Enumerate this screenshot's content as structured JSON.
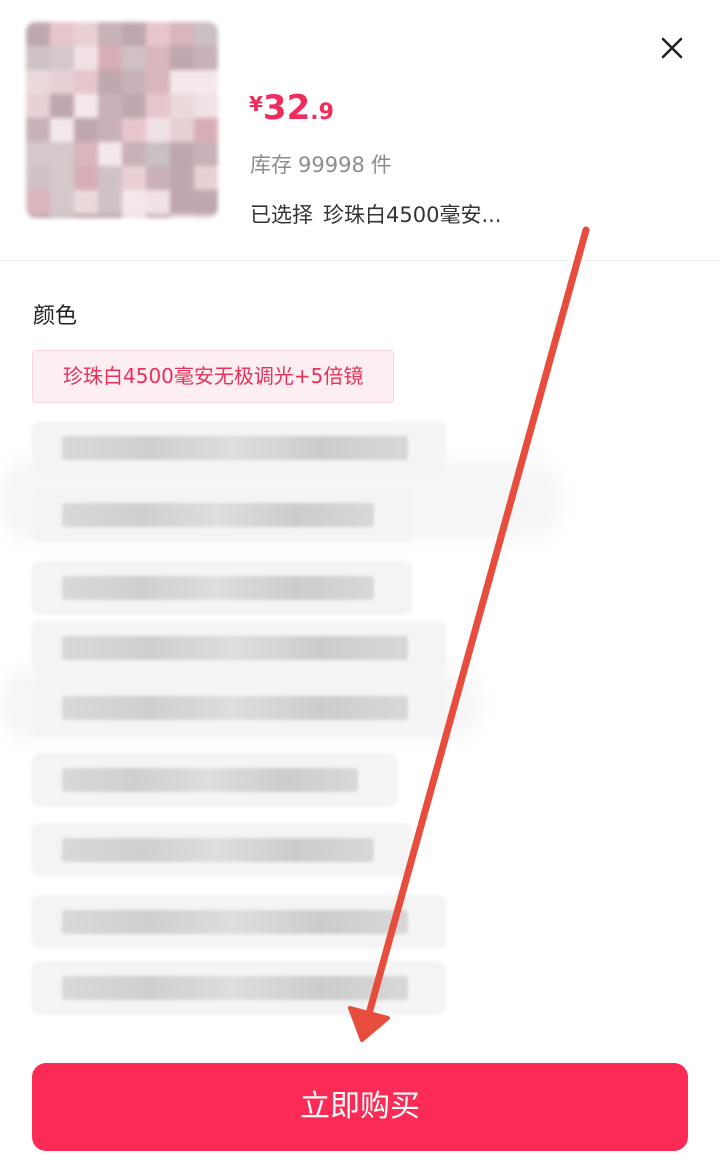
{
  "product": {
    "price": {
      "currency": "¥",
      "integer": "32",
      "decimal": ".9"
    },
    "stock": {
      "label": "库存",
      "count": "99998",
      "unit": "件"
    },
    "selected": {
      "label": "已选择",
      "value": "珍珠白4500毫安..."
    }
  },
  "spec": {
    "section_label": "颜色",
    "selected_option": "珍珠白4500毫安无极调光+5倍镜"
  },
  "actions": {
    "buy_label": "立即购买"
  },
  "colors": {
    "accent": "#fc2b55",
    "price": "#f02d5c",
    "annotation_arrow": "#e74c3c"
  },
  "icons": {
    "close": "close-icon"
  }
}
